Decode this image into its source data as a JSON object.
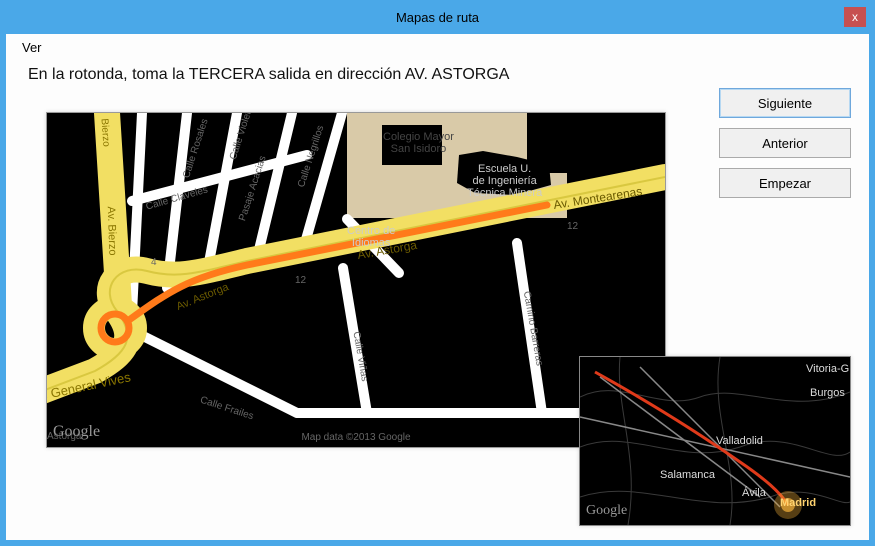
{
  "window": {
    "title": "Mapas de ruta",
    "close_symbol": "x"
  },
  "menu": {
    "ver": "Ver"
  },
  "instruction": "En la rotonda, toma la TERCERA salida en dirección AV. ASTORGA",
  "buttons": {
    "next": "Siguiente",
    "prev": "Anterior",
    "start": "Empezar"
  },
  "main_map": {
    "logo": "Google",
    "attribution": "Map data ©2013 Google",
    "roads": {
      "av_astorga_1": "Av. Astorga",
      "av_astorga_2": "Av. Astorga",
      "av_montearenas": "Av. Montearenas",
      "calle_general_vives": "Calle General Vives",
      "av_bierzo": "Av. Bierzo",
      "av_bierzo_top": "Bierzo",
      "calle_rosales": "Calle Rosales",
      "calle_violetas": "Calle Violetas",
      "pasaje_acacias": "Pasaje Acacias",
      "calle_negrillos": "Calle Negrillos",
      "calle_claveles": "Calle Claveles",
      "calle_frailes": "Calle Frailes",
      "calle_vinas": "Calle Viñas",
      "camino_barreras": "Camino Barreras",
      "av_astorga_bottom": "Astorga",
      "n12_1": "12",
      "n12_2": "12",
      "n4": "4"
    },
    "places": {
      "colegio": "Colegio Mayor\nSan Isidoro",
      "escuela": "Escuela U.\nde Ingeniería\nTécnica Minera",
      "centro": "Centro de\nIdiomas"
    }
  },
  "mini_map": {
    "logo": "Google",
    "cities": {
      "madrid": "Madrid",
      "valladolid": "Valladolid",
      "salamanca": "Salamanca",
      "burgos": "Burgos",
      "avila": "Ávila",
      "vitoria": "Vitoria-G"
    }
  }
}
